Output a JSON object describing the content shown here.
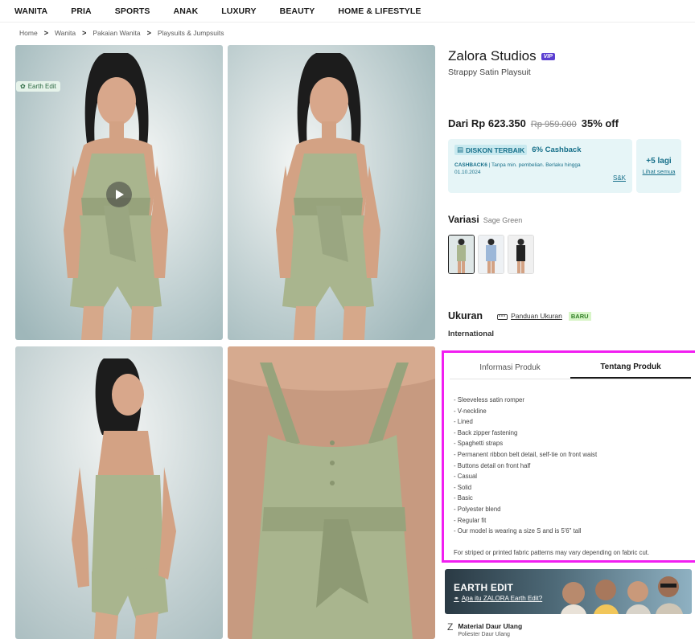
{
  "nav": [
    "WANITA",
    "PRIA",
    "SPORTS",
    "ANAK",
    "LUXURY",
    "BEAUTY",
    "HOME & LIFESTYLE"
  ],
  "breadcrumb": [
    "Home",
    "Wanita",
    "Pakaian Wanita",
    "Playsuits & Jumpsuits"
  ],
  "gallery": {
    "earth_tag": "Earth Edit"
  },
  "product": {
    "brand": "Zalora Studios",
    "vip_badge": "VIP",
    "name": "Strappy Satin Playsuit",
    "price": "Dari Rp 623.350",
    "old_price": "Rp 959.000",
    "discount": "35% off"
  },
  "promo": {
    "badge": "DISKON TERBAIK",
    "cashback": "6% Cashback",
    "code": "CASHBACK6",
    "desc": " | Tanpa min. pembelian. Berlaku hingga 01.10.2024",
    "terms": "S&K",
    "more_count": "+5 lagi",
    "more_link": "Lihat semua"
  },
  "variant": {
    "label": "Variasi",
    "selected": "Sage Green"
  },
  "size": {
    "label": "Ukuran",
    "guide": "Panduan Ukuran",
    "new_badge": "BARU",
    "system": "International"
  },
  "tabs": [
    "Informasi Produk",
    "Tentang Produk"
  ],
  "about": {
    "bullets": [
      "- Sleeveless satin romper",
      "- V-neckline",
      "- Lined",
      "- Back zipper fastening",
      "- Spaghetti straps",
      "- Permanent ribbon belt detail, self-tie on front waist",
      "- Buttons detail on front half",
      "- Casual",
      "- Solid",
      "- Basic",
      "- Polyester blend",
      "- Regular fit",
      "- Our model is wearing a size S and is 5'6\" tall"
    ],
    "footnote": "For striped or printed fabric patterns may vary depending on fabric cut."
  },
  "earth_edit": {
    "title": "EARTH EDIT",
    "link": "Apa itu ZALORA Earth Edit?"
  },
  "material": {
    "icon": "Z",
    "title": "Material Daur Ulang",
    "subtitle": "Poliester Daur Ulang"
  },
  "colors": {
    "accent": "#17708a",
    "promo_bg": "#e6f5f7",
    "highlight_border": "#f11ef1",
    "dress": "#a9b58e"
  }
}
